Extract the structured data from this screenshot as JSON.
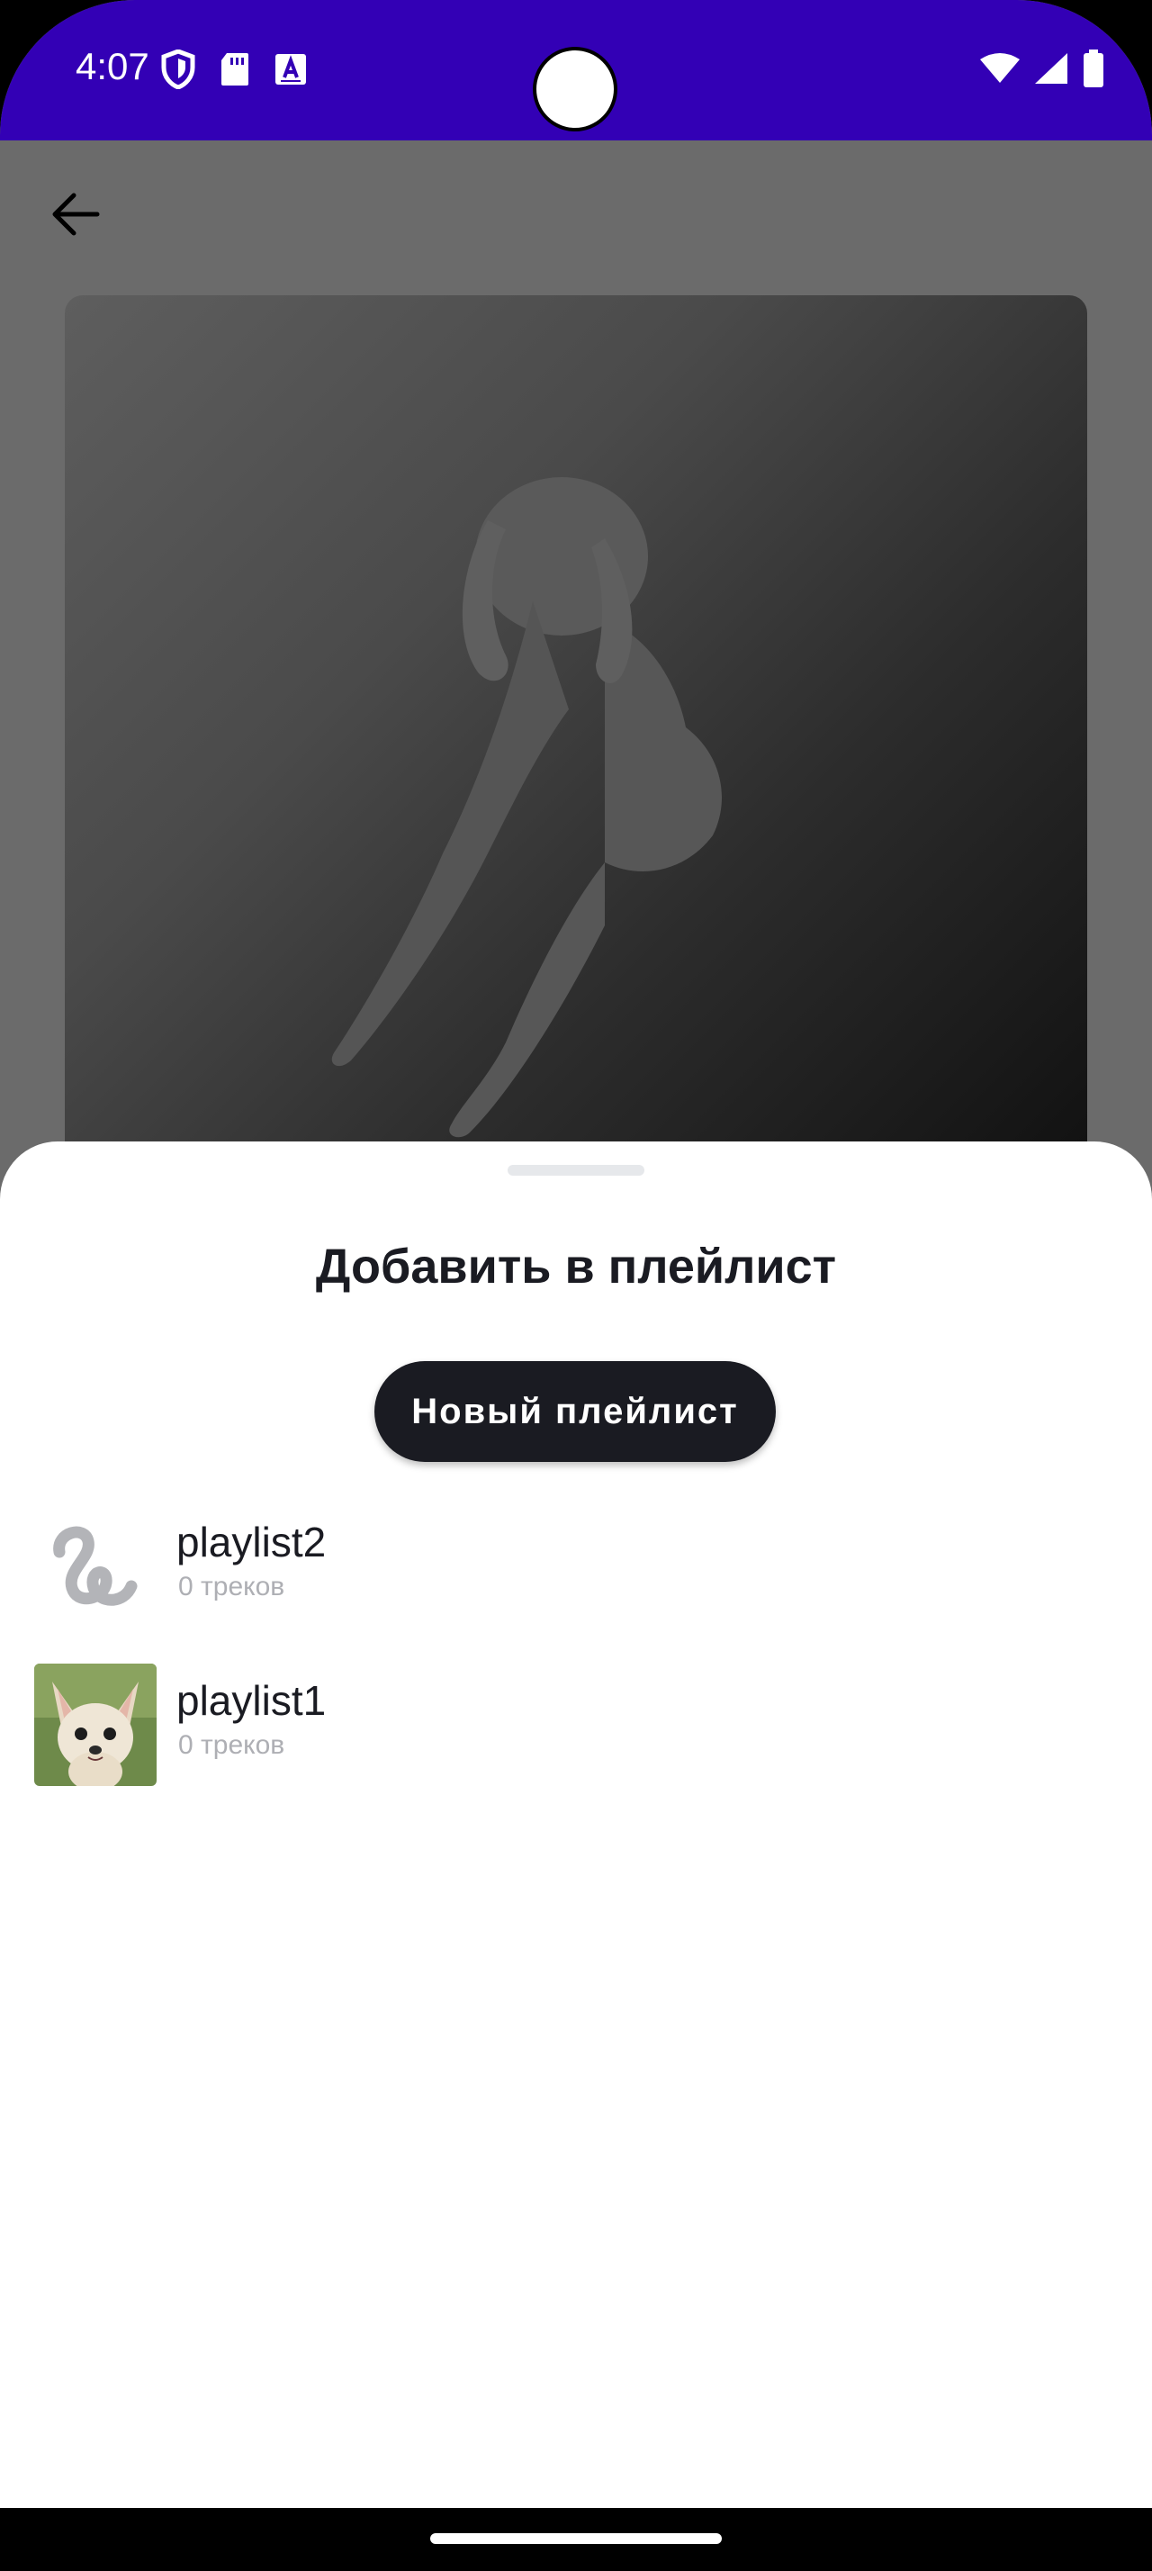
{
  "status_bar": {
    "time": "4:07",
    "left_icons": [
      "shield-icon",
      "sd-card-icon",
      "keyboard-icon"
    ],
    "right_icons": [
      "wifi-icon",
      "signal-icon",
      "battery-icon"
    ],
    "background": "#3300b5"
  },
  "header": {
    "back_icon": "arrow-left-icon"
  },
  "sheet": {
    "title": "Добавить в плейлист",
    "new_playlist_label": "Новый плейлист",
    "playlists": [
      {
        "name": "playlist2",
        "count": "0 треков",
        "thumb": "placeholder-squiggle"
      },
      {
        "name": "playlist1",
        "count": "0 треков",
        "thumb": "chihuahua-photo"
      }
    ]
  },
  "colors": {
    "dim_overlay": "#6b6b6b",
    "button_bg": "#1a1b22",
    "secondary_text": "#aeafb4"
  }
}
